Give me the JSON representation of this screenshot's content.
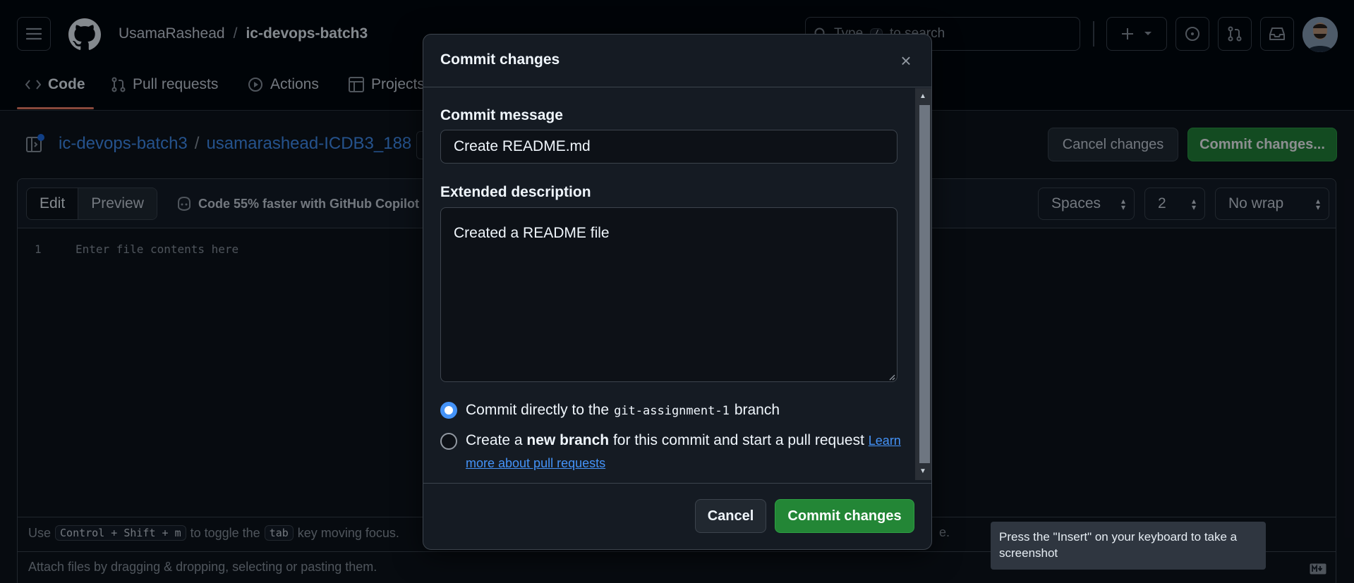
{
  "header": {
    "owner": "UsamaRashead",
    "separator": "/",
    "repo": "ic-devops-batch3",
    "search_prefix": "Type",
    "search_key": "/",
    "search_suffix": "to search"
  },
  "repo_tabs": [
    {
      "label": "Code"
    },
    {
      "label": "Pull requests"
    },
    {
      "label": "Actions"
    },
    {
      "label": "Projects"
    }
  ],
  "file_path": {
    "repo_link": "ic-devops-batch3",
    "sep1": "/",
    "folder_link": "usamarashead-ICDB3_188",
    "sep2": "/"
  },
  "page_actions": {
    "cancel_label": "Cancel changes",
    "commit_label": "Commit changes..."
  },
  "editor": {
    "edit_tab": "Edit",
    "preview_tab": "Preview",
    "copilot_text": "Code 55% faster with GitHub Copilot",
    "indent_mode": "Spaces",
    "indent_size": "2",
    "wrap_mode": "No wrap",
    "line_number": "1",
    "placeholder": "Enter file contents here",
    "hint_use": "Use",
    "hint_kbd": "Control + Shift + m",
    "hint_mid": "to toggle the",
    "hint_tab_kbd": "tab",
    "hint_end": "key moving focus.",
    "hint_tail": "e.",
    "attach_text": "Attach files by dragging & dropping, selecting or pasting them."
  },
  "dialog": {
    "title": "Commit changes",
    "close_glyph": "×",
    "commit_message_label": "Commit message",
    "commit_message_value": "Create README.md",
    "extended_label": "Extended description",
    "extended_value": "Created a README file",
    "option1_prefix": "Commit directly to the",
    "option1_branch": "git-assignment-1",
    "option1_suffix": "branch",
    "option2_prefix": "Create a",
    "option2_bold": "new branch",
    "option2_suffix": "for this commit and start a pull request",
    "option2_link1": "Learn",
    "option2_link2": "more about pull requests",
    "cancel_label": "Cancel",
    "commit_label": "Commit changes"
  },
  "tooltip": {
    "text": "Press the \"Insert\" on your keyboard to take a screenshot"
  }
}
